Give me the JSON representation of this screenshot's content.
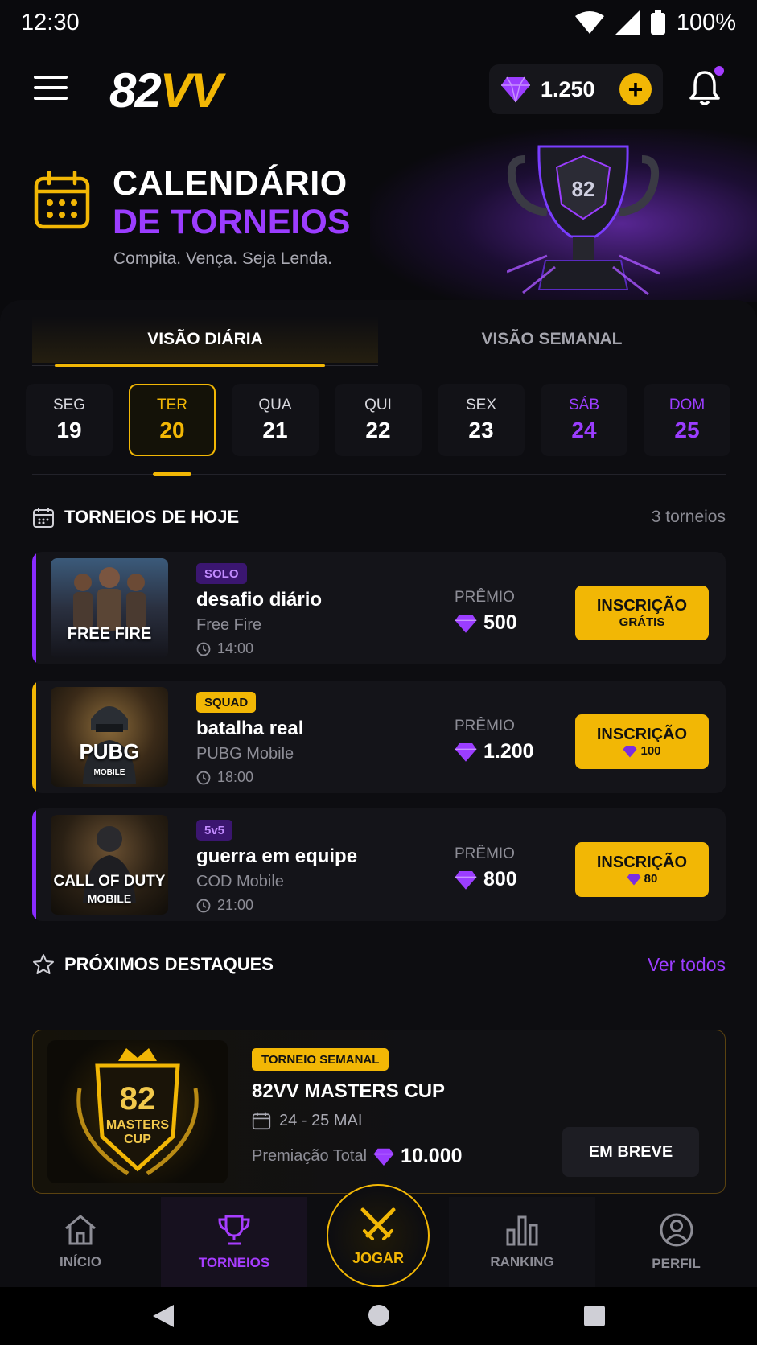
{
  "status": {
    "time": "12:30",
    "battery": "100%"
  },
  "header": {
    "logo_main": "82",
    "logo_accent": "VV",
    "gems": "1.250",
    "plus": "+"
  },
  "hero": {
    "title_line1": "CALENDÁRIO",
    "title_line2": "DE TORNEIOS",
    "subtitle": "Compita. Vença. Seja Lenda.",
    "trophy_text": "82"
  },
  "view_tabs": [
    {
      "label": "VISÃO DIÁRIA",
      "active": true
    },
    {
      "label": "VISÃO SEMANAL",
      "active": false
    }
  ],
  "days": [
    {
      "name": "SEG",
      "num": "19"
    },
    {
      "name": "TER",
      "num": "20"
    },
    {
      "name": "QUA",
      "num": "21"
    },
    {
      "name": "QUI",
      "num": "22"
    },
    {
      "name": "SEX",
      "num": "23"
    },
    {
      "name": "SÁB",
      "num": "24"
    },
    {
      "name": "DOM",
      "num": "25"
    }
  ],
  "today": {
    "title": "TORNEIOS DE HOJE",
    "count": "3 torneios"
  },
  "tournaments": [
    {
      "badge": "SOLO",
      "name": "desafio diário",
      "game": "Free Fire",
      "thumb_label": "FREE FIRE",
      "time": "14:00",
      "prize_label": "PRÊMIO",
      "prize": "500",
      "cta": "INSCRIÇÃO",
      "cta_sub": "GRÁTIS",
      "accent": "#8a2cff"
    },
    {
      "badge": "SQUAD",
      "name": "batalha real",
      "game": "PUBG Mobile",
      "thumb_label": "PUBG",
      "thumb_sub": "MOBILE",
      "time": "18:00",
      "prize_label": "PRÊMIO",
      "prize": "1.200",
      "cta": "INSCRIÇÃO",
      "cta_sub": "100",
      "accent": "#f2b705"
    },
    {
      "badge": "5v5",
      "name": "guerra em equipe",
      "game": "COD Mobile",
      "thumb_label": "CALL OF DUTY",
      "thumb_sub": "MOBILE",
      "time": "21:00",
      "prize_label": "PRÊMIO",
      "prize": "800",
      "cta": "INSCRIÇÃO",
      "cta_sub": "80",
      "accent": "#8a2cff"
    }
  ],
  "highlights": {
    "title": "PRÓXIMOS DESTAQUES",
    "link": "Ver todos"
  },
  "featured": {
    "badge": "TORNEIO SEMANAL",
    "title": "82VV MASTERS CUP",
    "date": "24 - 25 MAI",
    "prize_label": "Premiação Total",
    "prize": "10.000",
    "button": "EM BREVE",
    "thumb_num": "82",
    "thumb_l1": "MASTERS",
    "thumb_l2": "CUP"
  },
  "nav": [
    {
      "label": "INÍCIO",
      "icon": "home-icon"
    },
    {
      "label": "TORNEIOS",
      "icon": "trophy-icon"
    },
    {
      "label": "JOGAR",
      "icon": "crossed-swords-icon"
    },
    {
      "label": "RANKING",
      "icon": "bar-chart-icon"
    },
    {
      "label": "PERFIL",
      "icon": "user-icon"
    }
  ],
  "colors": {
    "gold": "#f2b705",
    "purple": "#9b3dff",
    "bg": "#0a0a0d",
    "card": "#141419"
  }
}
